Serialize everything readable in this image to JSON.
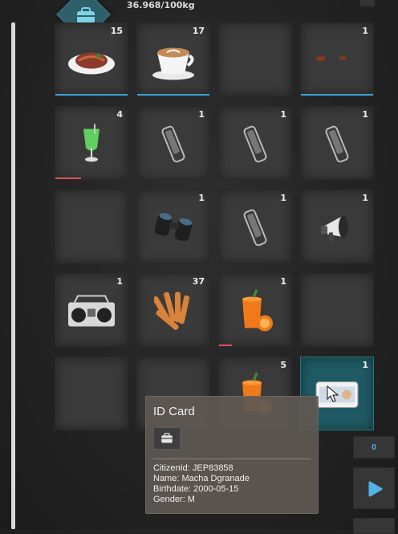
{
  "header": {
    "weight": "36.968/100kg",
    "bag_icon": "backpack-icon"
  },
  "slots": [
    {
      "id": 1,
      "count": "15",
      "item": "steak",
      "bar": "blue",
      "bar_fill": 1.0
    },
    {
      "id": 2,
      "count": "17",
      "item": "coffee",
      "bar": "blue",
      "bar_fill": 1.0
    },
    {
      "id": 3,
      "count": "",
      "item": "empty"
    },
    {
      "id": 4,
      "count": "1",
      "item": "rifle",
      "bar": "blue",
      "bar_fill": 1.0
    },
    {
      "id": 5,
      "count": "4",
      "item": "green-cocktail",
      "bar": "red",
      "bar_fill": 0.35
    },
    {
      "id": 6,
      "count": "1",
      "item": "phone"
    },
    {
      "id": 7,
      "count": "1",
      "item": "phone"
    },
    {
      "id": 8,
      "count": "1",
      "item": "phone"
    },
    {
      "id": 9,
      "count": "",
      "item": "empty"
    },
    {
      "id": 10,
      "count": "1",
      "item": "binoculars"
    },
    {
      "id": 11,
      "count": "1",
      "item": "phone"
    },
    {
      "id": 12,
      "count": "1",
      "item": "megaphone"
    },
    {
      "id": 13,
      "count": "1",
      "item": "boombox"
    },
    {
      "id": 14,
      "count": "37",
      "item": "ammo"
    },
    {
      "id": 15,
      "count": "1",
      "item": "orange-juice",
      "bar": "red",
      "bar_fill": 0.18
    },
    {
      "id": 16,
      "count": "",
      "item": "empty"
    },
    {
      "id": 17,
      "count": "",
      "item": "empty"
    },
    {
      "id": 18,
      "count": "",
      "item": "empty"
    },
    {
      "id": 19,
      "count": "5",
      "item": "orange-juice"
    },
    {
      "id": 20,
      "count": "1",
      "item": "id-card",
      "selected": true
    }
  ],
  "tooltip": {
    "title": "ID Card",
    "lines": {
      "citizen": "CitizenId: JEP83858",
      "name": "Name: Macha Dgranade",
      "birthdate": "Birthdate: 2000-05-15",
      "gender": "Gender: M"
    }
  },
  "side": {
    "counter": "0"
  },
  "colors": {
    "accent": "#3fa0d8",
    "selected_slot": "#1f5a64",
    "durability_low": "#d9534f"
  }
}
